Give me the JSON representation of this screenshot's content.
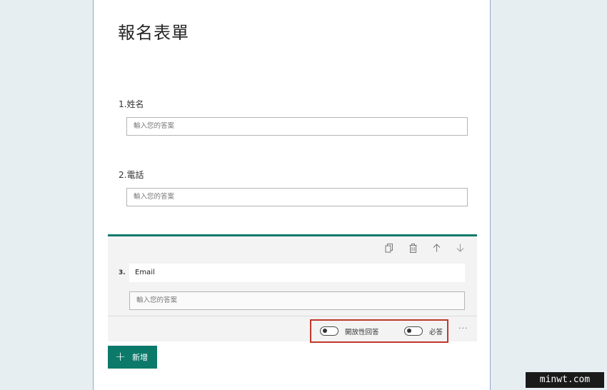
{
  "form": {
    "title": "報名表單",
    "questions": [
      {
        "label": "1.姓名",
        "placeholder": "輸入您的答案"
      },
      {
        "label": "2.電話",
        "placeholder": "輸入您的答案"
      }
    ],
    "active_question": {
      "number": "3.",
      "title": "Email",
      "placeholder": "輸入您的答案",
      "toolbar_icons": [
        "copy-icon",
        "trash-icon",
        "arrow-up-icon",
        "arrow-down-icon"
      ],
      "options": {
        "open_answer_label": "開放性回答",
        "open_answer_on": false,
        "required_label": "必答",
        "required_on": false,
        "more_label": "···"
      }
    },
    "add_button": {
      "label": "新增",
      "icon": "plus-icon"
    }
  },
  "watermark": "minwt.com",
  "colors": {
    "accent": "#0b7a6b",
    "highlight": "#c0392b"
  }
}
